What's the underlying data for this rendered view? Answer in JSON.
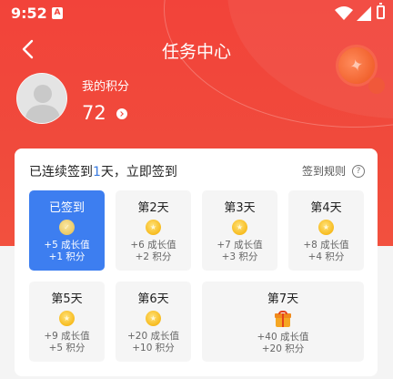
{
  "status_bar": {
    "time": "9:52",
    "app_badge": "A"
  },
  "nav": {
    "title": "任务中心"
  },
  "profile": {
    "points_label": "我的积分",
    "points_value": "72"
  },
  "checkin": {
    "header_prefix": "已连续签到",
    "streak_days": "1",
    "header_suffix": "天，立即签到",
    "rules_label": "签到规则",
    "rules_icon": "?",
    "days": [
      {
        "label": "已签到",
        "growth": "+5 成长值",
        "points": "+1 积分",
        "signed": true
      },
      {
        "label": "第2天",
        "growth": "+6 成长值",
        "points": "+2 积分",
        "signed": false
      },
      {
        "label": "第3天",
        "growth": "+7 成长值",
        "points": "+3 积分",
        "signed": false
      },
      {
        "label": "第4天",
        "growth": "+8 成长值",
        "points": "+4 积分",
        "signed": false
      },
      {
        "label": "第5天",
        "growth": "+9 成长值",
        "points": "+5 积分",
        "signed": false
      },
      {
        "label": "第6天",
        "growth": "+20 成长值",
        "points": "+10 积分",
        "signed": false
      },
      {
        "label": "第7天",
        "growth": "+40 成长值",
        "points": "+20 积分",
        "signed": false,
        "reward": "gift-icon"
      }
    ]
  },
  "colors": {
    "primary_red": "#f2433a",
    "signed_blue": "#3d7ef0",
    "coin_gold": "#f7bb1e"
  }
}
